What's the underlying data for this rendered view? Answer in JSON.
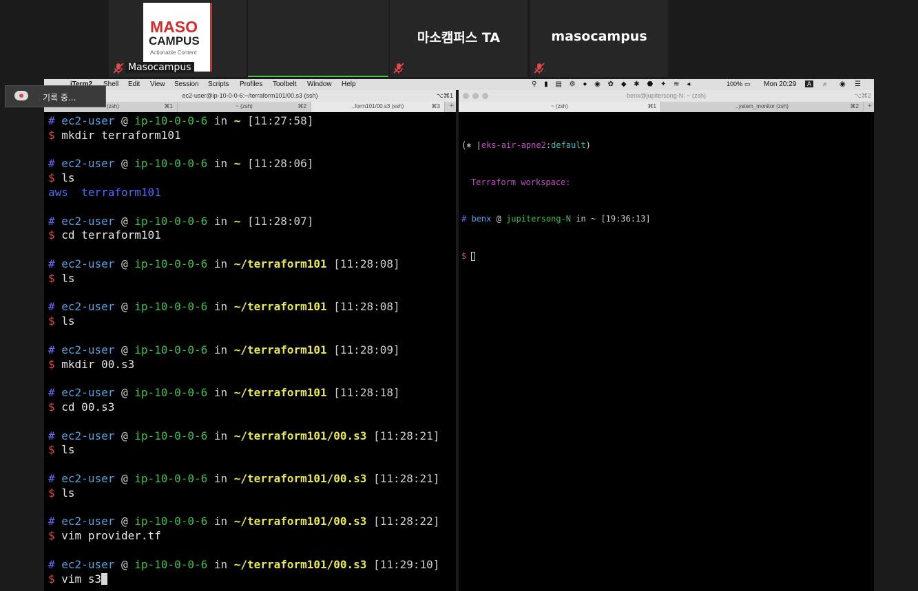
{
  "zoom_tiles": {
    "tile1": {
      "name": "Masocampus",
      "logo": {
        "line1": "MASO",
        "line2": "CAMPUS",
        "line3": "Actionable Content"
      }
    },
    "tile3": {
      "name": "마소캠퍼스 TA"
    },
    "tile4": {
      "name": "masocampus"
    }
  },
  "recording": {
    "label": "기록 중..."
  },
  "menubar": {
    "app": "iTerm2",
    "items": [
      "Shell",
      "Edit",
      "View",
      "Session",
      "Scripts",
      "Profiles",
      "Toolbelt",
      "Window",
      "Help"
    ],
    "battery": "100%",
    "clock": "Mon 20:29"
  },
  "left_window": {
    "title": "ec2-user@ip-10-0-0-6:~/terraform101/00.s3 (ssh)",
    "title_shortcut": "⌥⌘1",
    "tabs": [
      {
        "label": "~ (zsh)",
        "key": "⌘1"
      },
      {
        "label": "~ (zsh)",
        "key": "⌘2"
      },
      {
        "label": "..form101/00.s3 (ssh)",
        "key": "⌘3"
      }
    ],
    "terminal": [
      {
        "hash": "#",
        "user": "ec2-user",
        "at": "@",
        "host": "ip-10-0-0-6",
        "in": "in",
        "path": "~",
        "time": "[11:27:58]"
      },
      {
        "cmd": "mkdir terraform101"
      },
      {
        "blank": true
      },
      {
        "hash": "#",
        "user": "ec2-user",
        "at": "@",
        "host": "ip-10-0-0-6",
        "in": "in",
        "path": "~",
        "time": "[11:28:06]"
      },
      {
        "cmd": "ls"
      },
      {
        "output": "aws  terraform101"
      },
      {
        "blank": true
      },
      {
        "hash": "#",
        "user": "ec2-user",
        "at": "@",
        "host": "ip-10-0-0-6",
        "in": "in",
        "path": "~",
        "time": "[11:28:07]"
      },
      {
        "cmd": "cd terraform101"
      },
      {
        "blank": true
      },
      {
        "hash": "#",
        "user": "ec2-user",
        "at": "@",
        "host": "ip-10-0-0-6",
        "in": "in",
        "path": "~/terraform101",
        "time": "[11:28:08]"
      },
      {
        "cmd": "ls"
      },
      {
        "blank": true
      },
      {
        "hash": "#",
        "user": "ec2-user",
        "at": "@",
        "host": "ip-10-0-0-6",
        "in": "in",
        "path": "~/terraform101",
        "time": "[11:28:08]"
      },
      {
        "cmd": "ls"
      },
      {
        "blank": true
      },
      {
        "hash": "#",
        "user": "ec2-user",
        "at": "@",
        "host": "ip-10-0-0-6",
        "in": "in",
        "path": "~/terraform101",
        "time": "[11:28:09]"
      },
      {
        "cmd": "mkdir 00.s3"
      },
      {
        "blank": true
      },
      {
        "hash": "#",
        "user": "ec2-user",
        "at": "@",
        "host": "ip-10-0-0-6",
        "in": "in",
        "path": "~/terraform101",
        "time": "[11:28:18]"
      },
      {
        "cmd": "cd 00.s3"
      },
      {
        "blank": true
      },
      {
        "hash": "#",
        "user": "ec2-user",
        "at": "@",
        "host": "ip-10-0-0-6",
        "in": "in",
        "path": "~/terraform101/00.s3",
        "time": "[11:28:21]"
      },
      {
        "cmd": "ls"
      },
      {
        "blank": true
      },
      {
        "hash": "#",
        "user": "ec2-user",
        "at": "@",
        "host": "ip-10-0-0-6",
        "in": "in",
        "path": "~/terraform101/00.s3",
        "time": "[11:28:21]"
      },
      {
        "cmd": "ls"
      },
      {
        "blank": true
      },
      {
        "hash": "#",
        "user": "ec2-user",
        "at": "@",
        "host": "ip-10-0-0-6",
        "in": "in",
        "path": "~/terraform101/00.s3",
        "time": "[11:28:22]"
      },
      {
        "cmd": "vim provider.tf"
      },
      {
        "blank": true
      },
      {
        "hash": "#",
        "user": "ec2-user",
        "at": "@",
        "host": "ip-10-0-0-6",
        "in": "in",
        "path": "~/terraform101/00.s3",
        "time": "[11:29:10]"
      },
      {
        "cmd": "vim s3",
        "cursor": true
      }
    ]
  },
  "right_window": {
    "title": "benx@jupitersong-N: ~ (zsh)",
    "title_shortcut": "⌥⌘2",
    "tabs": [
      {
        "label": "~ (zsh)",
        "key": "⌘1"
      },
      {
        "label": "..ystem_monitor (zsh)",
        "key": "⌘2"
      }
    ],
    "terminal": {
      "k8s_prefix": "(⎈ |",
      "k8s_context": "eks-air-apne2",
      "k8s_sep": ":",
      "k8s_ns": "default",
      "k8s_suffix": ")",
      "tf_workspace": "Terraform workspace:",
      "prompt": {
        "hash": "#",
        "user": "benx",
        "at": "@",
        "host": "jupitersong-N",
        "in": "in",
        "path": "~",
        "time": "[19:36:13]"
      },
      "dollar": "$"
    }
  }
}
